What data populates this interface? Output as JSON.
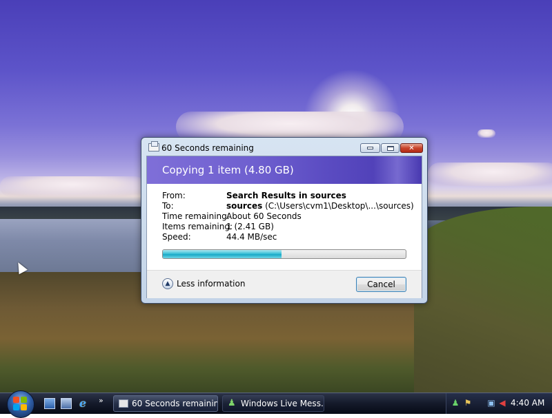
{
  "window": {
    "title": "60 Seconds remaining",
    "banner_title": "Copying 1 item (4.80 GB)",
    "details": {
      "from_label": "From:",
      "from_value": "Search Results in sources",
      "to_label": "To:",
      "to_value_bold": "sources",
      "to_value_path": "(C:\\Users\\cvm1\\Desktop\\...\\sources)",
      "time_label": "Time remaining:",
      "time_value": "About 60 Seconds",
      "items_label": "Items remaining:",
      "items_value": "1 (2.41 GB)",
      "speed_label": "Speed:",
      "speed_value": "44.4 MB/sec"
    },
    "progress_percent": 49,
    "less_info_label": "Less information",
    "cancel_label": "Cancel"
  },
  "taskbar": {
    "tasks": [
      {
        "label": "60 Seconds remaining"
      },
      {
        "label": "Windows Live Mess..."
      }
    ],
    "chevron": "»",
    "clock": "4:40 AM"
  },
  "colors": {
    "banner": "#5b4cc2",
    "progress_fill": "#18a8c6",
    "close_button": "#c8442c"
  }
}
